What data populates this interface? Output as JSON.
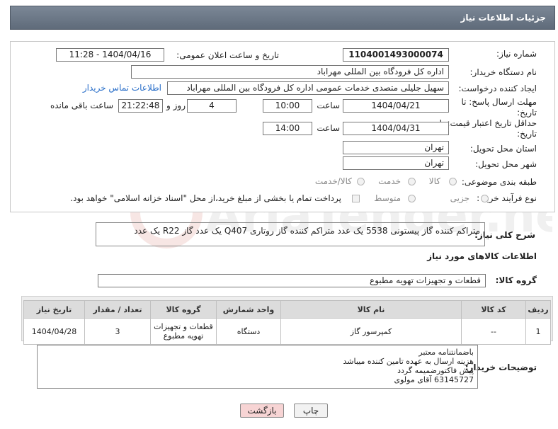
{
  "window": {
    "title": "جزئیات اطلاعات نیاز"
  },
  "form": {
    "need_number_label": "شماره نیاز:",
    "need_number": "1104001493000074",
    "announce_label": "تاریخ و ساعت اعلان عمومی:",
    "announce_value": "1404/04/16 - 11:28",
    "buyer_org_label": "نام دستگاه خریدار:",
    "buyer_org": "اداره کل فرودگاه بین المللی مهراباد",
    "creator_label": "ایجاد کننده درخواست:",
    "creator": "سهیل جلیلی متصدی خدمات عمومی اداره کل فرودگاه بین المللی مهراباد",
    "contact_link": "اطلاعات تماس خریدار",
    "deadline_label": "مهلت ارسال پاسخ: تا تاریخ:",
    "deadline_date": "1404/04/21",
    "time_label": "ساعت",
    "deadline_time": "10:00",
    "days_value": "4",
    "days_label": "روز و",
    "remaining_time": "21:22:48",
    "remaining_label": "ساعت باقی مانده",
    "validity_label": "حداقل تاریخ اعتبار قیمت: تا تاریخ:",
    "validity_date": "1404/04/31",
    "validity_time_label": "ساعت",
    "validity_time": "14:00",
    "province_label": "استان محل تحویل:",
    "province": "تهران",
    "city_label": "شهر محل تحویل:",
    "city": "تهران",
    "category_label": "طبقه بندی موضوعی:",
    "category_options": [
      "کالا",
      "خدمت",
      "کالا/خدمت"
    ],
    "process_label": "نوع فرآیند خرید :",
    "process_options": [
      "جزیی",
      "متوسط"
    ],
    "payment_note": "پرداخت تمام یا بخشی از مبلغ خرید،از محل \"اسناد خزانه اسلامی\" خواهد بود."
  },
  "description": {
    "label": "شرح کلی نیاز:",
    "text": "متراکم کننده گاز پیستونی 5538 یک عدد متراکم کننده گاز روتاری Q407 یک عدد گاز R22 یک عدد"
  },
  "goods_info_title": "اطلاعات کالاهای مورد نیاز",
  "goods_group": {
    "label": "گروه کالا:",
    "value": "قطعات و تجهیزات تهویه مطبوع"
  },
  "table": {
    "headers": [
      "ردیف",
      "کد کالا",
      "نام کالا",
      "واحد شمارش",
      "گروه کالا",
      "تعداد / مقدار",
      "تاریخ نیاز"
    ],
    "rows": [
      {
        "row": "1",
        "code": "--",
        "name": "کمپرسور گاز",
        "unit": "دستگاه",
        "group": "قطعات و تجهیزات تهویه مطبوع",
        "qty": "3",
        "date": "1404/04/28"
      }
    ]
  },
  "buyer_notes": {
    "label": "توضیحات خریدار:",
    "lines": [
      "باضمانتنامه معتبر",
      "هزینه ارسال به عهده تامین کننده میباشد",
      "پیش فاکتورضمیمه گردد",
      "63145727 آقای مولوی"
    ]
  },
  "buttons": {
    "print": "چاپ",
    "back": "بازگشت"
  },
  "watermark": "AriaTender.net",
  "colors": {
    "titlebar": "#6b7686",
    "link": "#2a6fc9",
    "back_button": "#f7d4d4",
    "print_button": "#f2f2f2"
  }
}
